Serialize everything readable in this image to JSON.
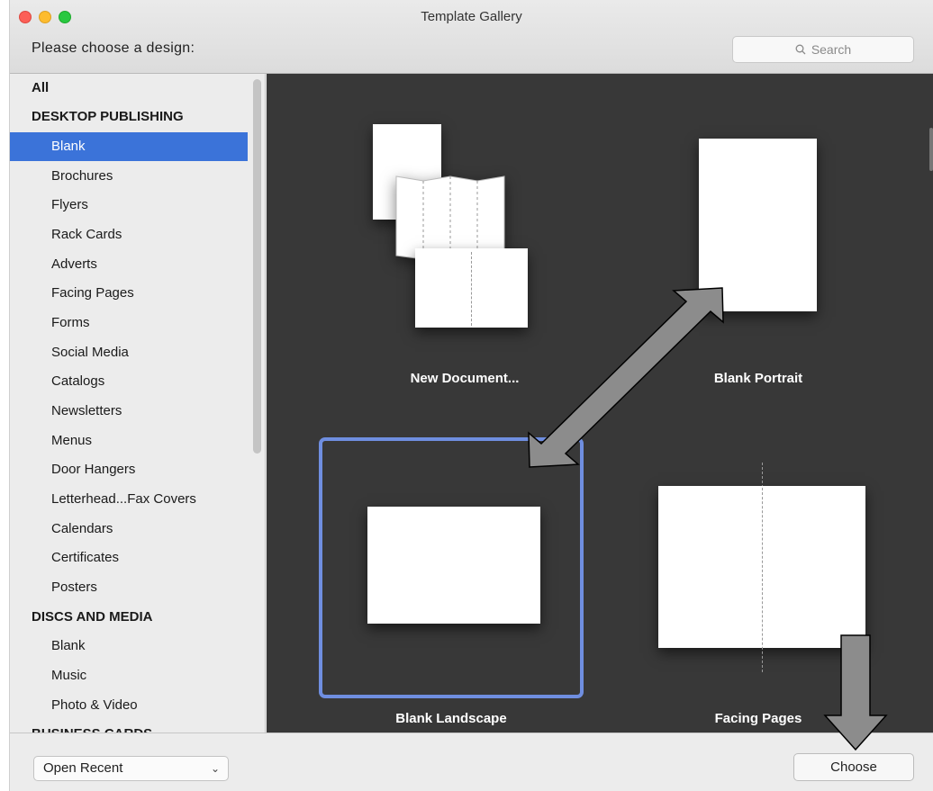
{
  "window": {
    "title": "Template Gallery",
    "prompt": "Please choose a design:"
  },
  "search": {
    "placeholder": "Search"
  },
  "sidebar": {
    "items": [
      {
        "label": "All",
        "kind": "header"
      },
      {
        "label": "DESKTOP PUBLISHING",
        "kind": "header"
      },
      {
        "label": "Blank",
        "kind": "sub",
        "selected": true
      },
      {
        "label": "Brochures",
        "kind": "sub"
      },
      {
        "label": "Flyers",
        "kind": "sub"
      },
      {
        "label": "Rack Cards",
        "kind": "sub"
      },
      {
        "label": "Adverts",
        "kind": "sub"
      },
      {
        "label": "Facing Pages",
        "kind": "sub"
      },
      {
        "label": "Forms",
        "kind": "sub"
      },
      {
        "label": "Social Media",
        "kind": "sub"
      },
      {
        "label": "Catalogs",
        "kind": "sub"
      },
      {
        "label": "Newsletters",
        "kind": "sub"
      },
      {
        "label": "Menus",
        "kind": "sub"
      },
      {
        "label": "Door Hangers",
        "kind": "sub"
      },
      {
        "label": "Letterhead...Fax Covers",
        "kind": "sub"
      },
      {
        "label": "Calendars",
        "kind": "sub"
      },
      {
        "label": "Certificates",
        "kind": "sub"
      },
      {
        "label": "Posters",
        "kind": "sub"
      },
      {
        "label": "DISCS AND MEDIA",
        "kind": "header"
      },
      {
        "label": "Blank",
        "kind": "sub"
      },
      {
        "label": "Music",
        "kind": "sub"
      },
      {
        "label": "Photo & Video",
        "kind": "sub"
      },
      {
        "label": "BUSINESS CARDS",
        "kind": "header"
      }
    ]
  },
  "gallery": {
    "tiles": [
      {
        "label": "New Document..."
      },
      {
        "label": "Blank Portrait"
      },
      {
        "label": "Blank Landscape",
        "selected": true
      },
      {
        "label": "Facing Pages"
      }
    ]
  },
  "footer": {
    "open_recent": "Open Recent",
    "choose": "Choose"
  },
  "colors": {
    "selection": "#3b73d9",
    "gallery_bg": "#383838",
    "tile_highlight": "#6f8ee0",
    "annotation_arrow": "#8c8c8c"
  }
}
